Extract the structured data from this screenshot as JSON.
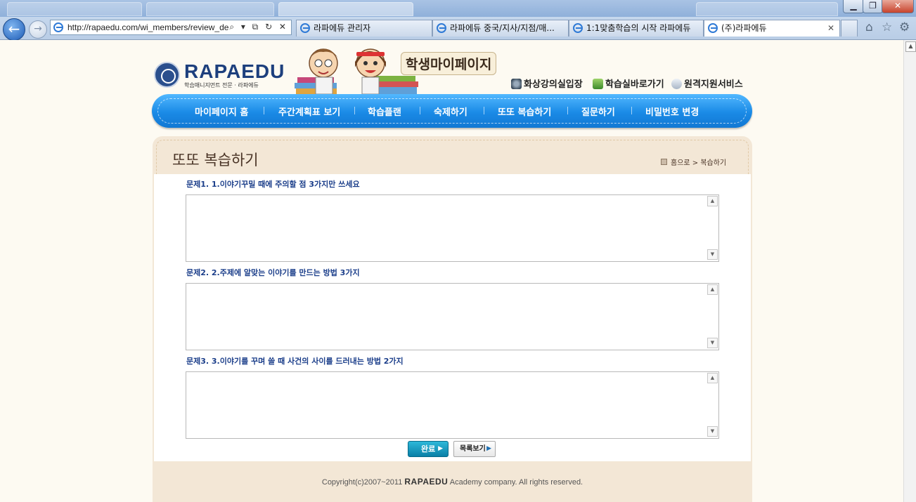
{
  "browser": {
    "address_url": "http://rapaedu.com/wi_members/review_de",
    "address_tools": "⌕ ▾ ⧉ ↻ ✕",
    "tabs": [
      {
        "label": "라파에듀 관리자",
        "active": false
      },
      {
        "label": "라파에듀 중국/지사/지점/매...",
        "active": false
      },
      {
        "label": "1:1맞춤학습의 시작 라파에듀",
        "active": false
      },
      {
        "label": "(주)라파에듀",
        "active": true
      }
    ],
    "tab_close": "✕",
    "window_controls": {
      "minimize": "▁",
      "restore": "❐",
      "close": "✕"
    },
    "right_icons": {
      "home": "⌂",
      "favorites": "☆",
      "tools": "⚙"
    }
  },
  "header": {
    "brand": "RAPAEDU",
    "brand_sub": "학습매니지먼트 전문 · 라파에듀",
    "mypage_title": "학생마이페이지",
    "quick_links": [
      {
        "label": "화상강의실입장",
        "icon": "webcam-icon"
      },
      {
        "label": "학습실바로가기",
        "icon": "book-icon"
      },
      {
        "label": "원격지원서비스",
        "icon": "mouse-icon"
      }
    ]
  },
  "nav": {
    "items": [
      {
        "label": "마이페이지 홈"
      },
      {
        "label": "주간계획표 보기"
      },
      {
        "label": "학습플랜"
      },
      {
        "label": "숙제하기"
      },
      {
        "label": "또또 복습하기"
      },
      {
        "label": "질문하기"
      },
      {
        "label": "비밀번호 변경"
      }
    ]
  },
  "page": {
    "title": "또또 복습하기",
    "breadcrumb": "홈으로 > 복습하기"
  },
  "questions": [
    {
      "label": "문제1. 1.이야기꾸밀 때에 주의할 점 3가지만 쓰세요",
      "answer": ""
    },
    {
      "label": "문제2. 2.주제에 알맞는 이야기를 만드는 방법 3가지",
      "answer": ""
    },
    {
      "label": "문제3. 3.이야기를 꾸며 쓸 때 사건의 사이를 드러내는 방법 2가지",
      "answer": ""
    }
  ],
  "buttons": {
    "done": "완료",
    "list": "목록보기"
  },
  "footer": {
    "copyright_prefix": "Copyright(c)2007~2011 ",
    "copyright_brand": "RAPAEDU",
    "copyright_suffix": " Academy company. All rights reserved."
  },
  "colors": {
    "nav_blue": "#1a8ae6",
    "question_blue": "#1b3e8a",
    "panel_beige": "#f3e7d6",
    "button_teal": "#0a7fa6"
  }
}
